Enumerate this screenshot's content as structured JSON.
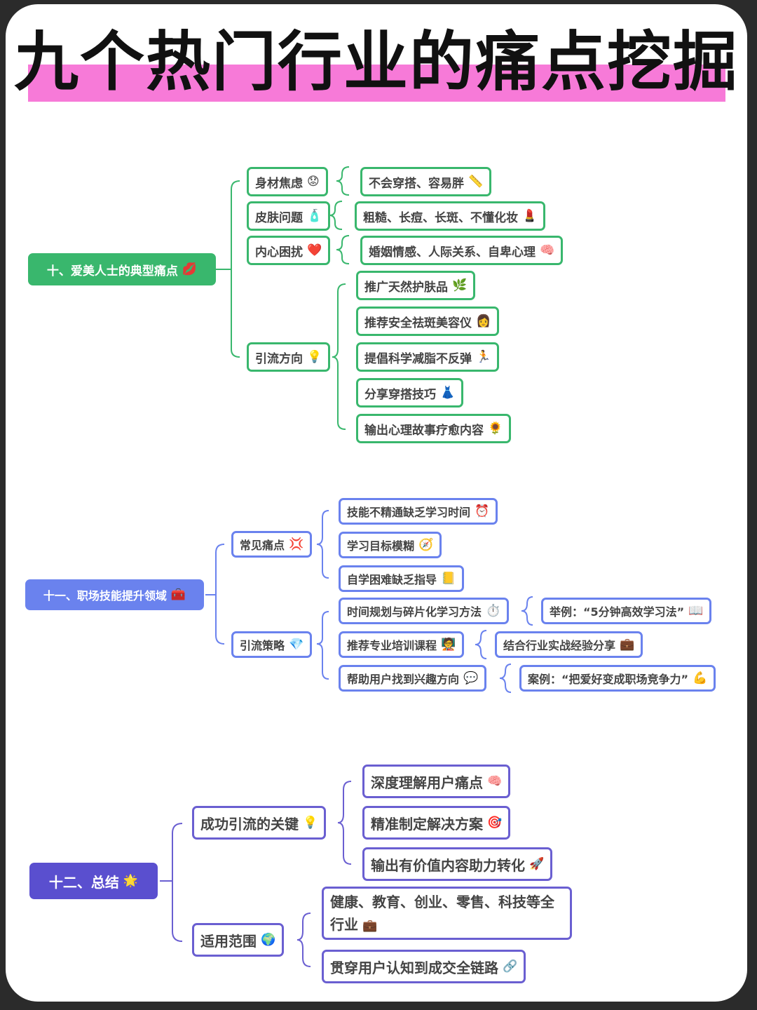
{
  "title": "九个热门行业的痛点挖掘",
  "colors": {
    "title_highlight": "#f77ad8",
    "green": "#39b76d",
    "blue": "#6a82ee",
    "purple": "#5a4fcf"
  },
  "s10": {
    "root": "十、爱美人士的典型痛点",
    "body": {
      "label": "身材焦虑",
      "child": "不会穿搭、容易胖"
    },
    "skin": {
      "label": "皮肤问题",
      "child": "粗糙、长痘、长斑、不懂化妆"
    },
    "heart": {
      "label": "内心困扰",
      "child": "婚姻情感、人际关系、自卑心理"
    },
    "guide": {
      "label": "引流方向",
      "items": [
        "推广天然护肤品",
        "推荐安全祛斑美容仪",
        "提倡科学减脂不反弹",
        "分享穿搭技巧",
        "输出心理故事疗愈内容"
      ]
    }
  },
  "s11": {
    "root": "十一、职场技能提升领域",
    "pain": {
      "label": "常见痛点",
      "items": [
        "技能不精通缺乏学习时间",
        "学习目标模糊",
        "自学困难缺乏指导"
      ]
    },
    "strategy": {
      "label": "引流策略",
      "items": [
        {
          "text": "时间规划与碎片化学习方法",
          "detail": "举例：“5分钟高效学习法”"
        },
        {
          "text": "推荐专业培训课程",
          "detail": "结合行业实战经验分享"
        },
        {
          "text": "帮助用户找到兴趣方向",
          "detail": "案例：“把爱好变成职场竞争力”"
        }
      ]
    }
  },
  "s12": {
    "root": "十二、总结",
    "key": {
      "label": "成功引流的关键",
      "items": [
        "深度理解用户痛点",
        "精准制定解决方案",
        "输出有价值内容助力转化"
      ]
    },
    "scope": {
      "label": "适用范围",
      "items": [
        "健康、教育、创业、零售、科技等全行业",
        "贯穿用户认知到成交全链路"
      ]
    }
  }
}
